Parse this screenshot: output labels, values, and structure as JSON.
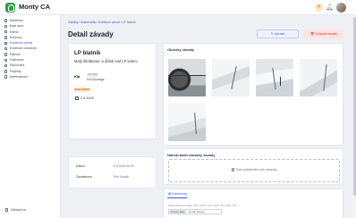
{
  "app": {
    "name": "Monty CA"
  },
  "colors": {
    "accent": "#3b5bdb",
    "brand": "#2f9e44",
    "danger": "#e03131",
    "warning": "#e8590c"
  },
  "sidebar": {
    "items": [
      {
        "label": "Nástěnka",
        "icon": "dashboard-icon"
      },
      {
        "label": "Moje auto",
        "icon": "car-icon"
      },
      {
        "label": "Klienti",
        "icon": "users-icon"
      },
      {
        "label": "Smlouvy",
        "icon": "contract-icon"
      },
      {
        "label": "Evidence závad",
        "icon": "alert-icon",
        "active": true
      },
      {
        "label": "Evidence odstávek",
        "icon": "calendar-icon"
      },
      {
        "label": "Pálenie",
        "icon": "fuel-icon"
      },
      {
        "label": "Fakturace",
        "icon": "invoice-icon"
      },
      {
        "label": "Parkoviště",
        "icon": "parking-icon"
      },
      {
        "label": "Projekty",
        "icon": "folder-icon"
      },
      {
        "label": "Administrace",
        "icon": "settings-icon"
      }
    ],
    "logout_label": "Odhlásit se"
  },
  "breadcrumb": {
    "items": [
      "Záložky",
      "Automobily",
      "Evidence závad",
      "LP blatník"
    ]
  },
  "page": {
    "title": "Detail závady"
  },
  "actions": {
    "edit_label": "Upravit",
    "delete_label": "Smazat závadu"
  },
  "defect": {
    "title": "LP blatník",
    "description": "Malý škrábanec a důlek nad LP kolem",
    "car_brand": "KIA",
    "plate": "8P6 9988",
    "model": "Kia Sportage",
    "status": "NAHLÁŠENO",
    "date": "2.9.2025"
  },
  "info": {
    "rows": [
      {
        "label": "Datum",
        "value": "5.6.2025 00:00"
      },
      {
        "label": "Zaznámeno",
        "value": "Petr Novák"
      }
    ]
  },
  "images": {
    "title": "Obrázky závady",
    "count": 5
  },
  "upload": {
    "title": "Nahrát další obrázky závady",
    "text": "Sem přetáhněte své obrázky"
  },
  "documents": {
    "tab_label": "Dokumenty",
    "hint": "Nahrát dokument (PDF, DOC, DOCX, XLS, XLSX, JPG, PNG, ZIP)",
    "file_button": "Choose Files",
    "file_placeholder": "No file chosen"
  }
}
